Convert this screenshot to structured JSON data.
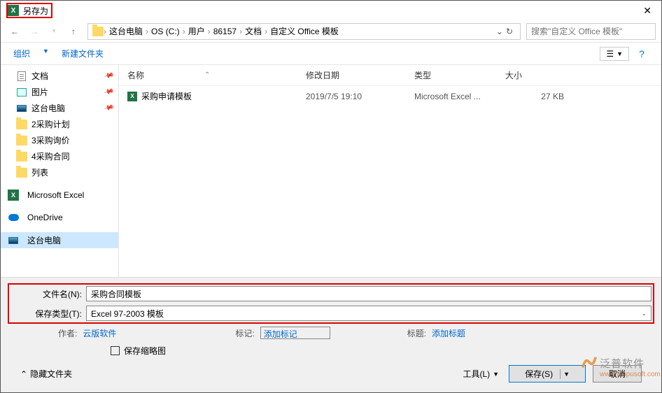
{
  "window": {
    "title": "另存为"
  },
  "nav": {
    "breadcrumb": [
      "这台电脑",
      "OS (C:)",
      "用户",
      "86157",
      "文档",
      "自定义 Office 模板"
    ],
    "search_placeholder": "搜索\"自定义 Office 模板\""
  },
  "toolbar": {
    "organize": "组织",
    "new_folder": "新建文件夹"
  },
  "sidebar": {
    "items": [
      {
        "label": "文档",
        "icon": "doc",
        "pin": true
      },
      {
        "label": "图片",
        "icon": "pic",
        "pin": true
      },
      {
        "label": "这台电脑",
        "icon": "pc",
        "pin": true
      },
      {
        "label": "2采购计划",
        "icon": "folder",
        "pin": false
      },
      {
        "label": "3采购询价",
        "icon": "folder",
        "pin": false
      },
      {
        "label": "4采购合同",
        "icon": "folder",
        "pin": false
      },
      {
        "label": "列表",
        "icon": "folder",
        "pin": false
      }
    ],
    "excel": "Microsoft Excel",
    "onedrive": "OneDrive",
    "thispc": "这台电脑"
  },
  "columns": {
    "name": "名称",
    "date": "修改日期",
    "type": "类型",
    "size": "大小"
  },
  "files": [
    {
      "name": "采购申请模板",
      "date": "2019/7/5 19:10",
      "type": "Microsoft Excel ...",
      "size": "27 KB"
    }
  ],
  "form": {
    "filename_label": "文件名(N):",
    "filename_value": "采购合同模板",
    "filetype_label": "保存类型(T):",
    "filetype_value": "Excel 97-2003 模板",
    "author_label": "作者:",
    "author_value": "云版软件",
    "tags_label": "标记:",
    "tags_value": "添加标记",
    "title_label": "标题:",
    "title_value": "添加标题",
    "thumb_label": "保存缩略图"
  },
  "actions": {
    "hide_folders": "隐藏文件夹",
    "tools": "工具(L)",
    "save": "保存(S)",
    "cancel": "取消"
  },
  "watermark": {
    "title": "泛普软件",
    "url": "www.fanpusoft.com"
  }
}
